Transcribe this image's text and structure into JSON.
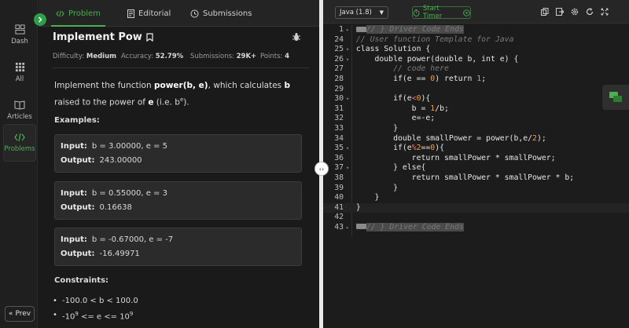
{
  "rail": {
    "items": [
      {
        "label": "Dash",
        "icon": "dashboard-icon"
      },
      {
        "label": "All",
        "icon": "grid-icon"
      },
      {
        "label": "Articles",
        "icon": "book-icon"
      },
      {
        "label": "Problems",
        "icon": "code-icon",
        "active": true
      }
    ],
    "prev": "Prev"
  },
  "tabs": [
    {
      "label": "Problem",
      "icon": "code-icon"
    },
    {
      "label": "Editorial",
      "icon": "document-icon"
    },
    {
      "label": "Submissions",
      "icon": "history-icon"
    }
  ],
  "problem": {
    "title": "Implement Pow",
    "difficulty_label": "Difficulty:",
    "difficulty": "Medium",
    "accuracy_label": "Accuracy:",
    "accuracy": "52.79%",
    "submissions_label": "Submissions:",
    "submissions": "29K+",
    "points_label": "Points:",
    "points": "4",
    "desc_1": "Implement the function ",
    "desc_fn": "power(b, e)",
    "desc_2": ", which calculates ",
    "desc_b": "b",
    "desc_3": " raised to the power of ",
    "desc_e": "e",
    "desc_4": " (i.e. b",
    "desc_sup": "e",
    "desc_5": ").",
    "examples_heading": "Examples:",
    "examples": [
      {
        "input_label": "Input:",
        "input": "b = 3.00000, e = 5",
        "output_label": "Output:",
        "output": "243.00000"
      },
      {
        "input_label": "Input:",
        "input": "b = 0.55000, e = 3",
        "output_label": "Output:",
        "output": "0.16638"
      },
      {
        "input_label": "Input:",
        "input": "b = -0.67000, e = -7",
        "output_label": "Output:",
        "output": "-16.49971"
      }
    ],
    "constraints_heading": "Constraints:",
    "constraint_1": "-100.0 < b < 100.0",
    "constraint_2_a": "-10",
    "constraint_2_sup1": "9",
    "constraint_2_b": " <= e <= 10",
    "constraint_2_sup2": "9"
  },
  "editor": {
    "language": "Java (1.8)",
    "timer": "Start Timer",
    "lines": [
      {
        "n": "1",
        "fold": "▸",
        "html": "<span class='mk'></span><span class='cm hl'>// } Driver Code Ends</span>"
      },
      {
        "n": "24",
        "fold": "",
        "html": "<span class='cm'>// User function Template for Java</span>"
      },
      {
        "n": "25",
        "fold": "▾",
        "html": "class Solution {"
      },
      {
        "n": "26",
        "fold": "▾",
        "html": "    double power(double b, int e) {"
      },
      {
        "n": "27",
        "fold": "",
        "html": "        <span class='cm'>// code here</span>"
      },
      {
        "n": "28",
        "fold": "",
        "html": "        if(e == <span class='n'>0</span>) return <span class='n'>1</span>;"
      },
      {
        "n": "29",
        "fold": "",
        "html": ""
      },
      {
        "n": "30",
        "fold": "▾",
        "html": "        if(e<span class='op'>&lt;</span><span class='n'>0</span>){"
      },
      {
        "n": "31",
        "fold": "",
        "html": "            b = <span class='n'>1</span>/b;"
      },
      {
        "n": "32",
        "fold": "",
        "html": "            e=-e;"
      },
      {
        "n": "33",
        "fold": "",
        "html": "        }"
      },
      {
        "n": "34",
        "fold": "",
        "html": "        double smallPower = power(b,e/<span class='n'>2</span>);"
      },
      {
        "n": "35",
        "fold": "▾",
        "html": "        if(e<span class='op'>%</span><span class='n'>2</span>==<span class='n'>0</span>){"
      },
      {
        "n": "36",
        "fold": "",
        "html": "            return smallPower * smallPower;"
      },
      {
        "n": "37",
        "fold": "▾",
        "html": "        } else{"
      },
      {
        "n": "38",
        "fold": "",
        "html": "            return smallPower * smallPower * b;"
      },
      {
        "n": "39",
        "fold": "",
        "html": "        }"
      },
      {
        "n": "40",
        "fold": "",
        "html": "    }"
      },
      {
        "n": "41",
        "fold": "",
        "html": "}",
        "current": true
      },
      {
        "n": "42",
        "fold": "",
        "html": ""
      },
      {
        "n": "43",
        "fold": "▸",
        "html": "<span class='mk'></span><span class='cm hl'>// } Driver Code Ends</span>"
      }
    ]
  },
  "colors": {
    "accent": "#4caf50",
    "background": "#1a1a1a"
  }
}
